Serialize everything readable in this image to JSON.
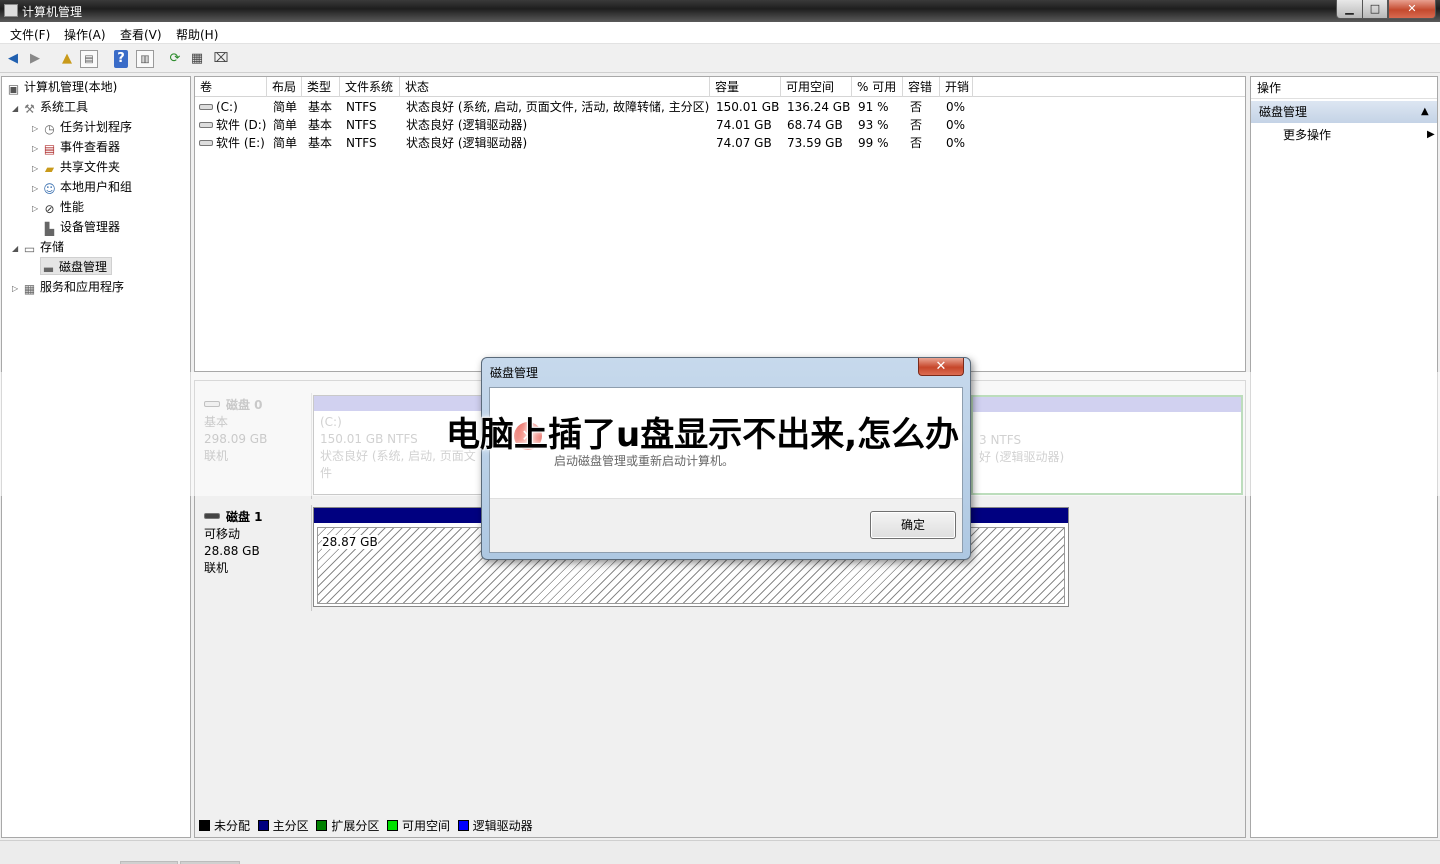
{
  "window": {
    "title": "计算机管理"
  },
  "menu": [
    "文件(F)",
    "操作(A)",
    "查看(V)",
    "帮助(H)"
  ],
  "tree": {
    "root": "计算机管理(本地)",
    "system_tools": "系统工具",
    "task_scheduler": "任务计划程序",
    "event_viewer": "事件查看器",
    "shared_folders": "共享文件夹",
    "local_users": "本地用户和组",
    "performance": "性能",
    "device_manager": "设备管理器",
    "storage": "存储",
    "disk_management": "磁盘管理",
    "services_apps": "服务和应用程序"
  },
  "volumes": {
    "headers": [
      "卷",
      "布局",
      "类型",
      "文件系统",
      "状态",
      "容量",
      "可用空间",
      "% 可用",
      "容错",
      "开销"
    ],
    "rows": [
      [
        "(C:)",
        "简单",
        "基本",
        "NTFS",
        "状态良好 (系统, 启动, 页面文件, 活动, 故障转储, 主分区)",
        "150.01 GB",
        "136.24 GB",
        "91 %",
        "否",
        "0%"
      ],
      [
        "软件 (D:)",
        "简单",
        "基本",
        "NTFS",
        "状态良好 (逻辑驱动器)",
        "74.01 GB",
        "68.74 GB",
        "93 %",
        "否",
        "0%"
      ],
      [
        "软件 (E:)",
        "简单",
        "基本",
        "NTFS",
        "状态良好 (逻辑驱动器)",
        "74.07 GB",
        "73.59 GB",
        "99 %",
        "否",
        "0%"
      ]
    ]
  },
  "disk0": {
    "name": "磁盘 0",
    "type": "基本",
    "size": "298.09 GB",
    "state": "联机",
    "part_c": {
      "name": "(C:)",
      "size": "150.01 GB NTFS",
      "status": "状态良好 (系统, 启动, 页面文件"
    },
    "part_right": {
      "size": "3 NTFS",
      "status": "好 (逻辑驱动器)"
    }
  },
  "disk1": {
    "name": "磁盘 1",
    "type": "可移动",
    "size": "28.88 GB",
    "state": "联机",
    "part": {
      "size": "28.87 GB"
    }
  },
  "legend": [
    "未分配",
    "主分区",
    "扩展分区",
    "可用空间",
    "逻辑驱动器"
  ],
  "legend_colors": [
    "#000000",
    "#000080",
    "#008000",
    "#00e000",
    "#0000ff"
  ],
  "actions": {
    "header": "操作",
    "section": "磁盘管理",
    "more": "更多操作"
  },
  "dialog": {
    "title": "磁盘管理",
    "close": "✕",
    "message": "启动磁盘管理或重新启动计算机。",
    "ok": "确定"
  },
  "caption": "电脑上插了u盘显示不出来,怎么办",
  "colors": {
    "primary_partition": "#000080",
    "logical_drive": "#9a9ade",
    "extended": "#4caf50",
    "accent_selection": "#c4d3e6"
  }
}
